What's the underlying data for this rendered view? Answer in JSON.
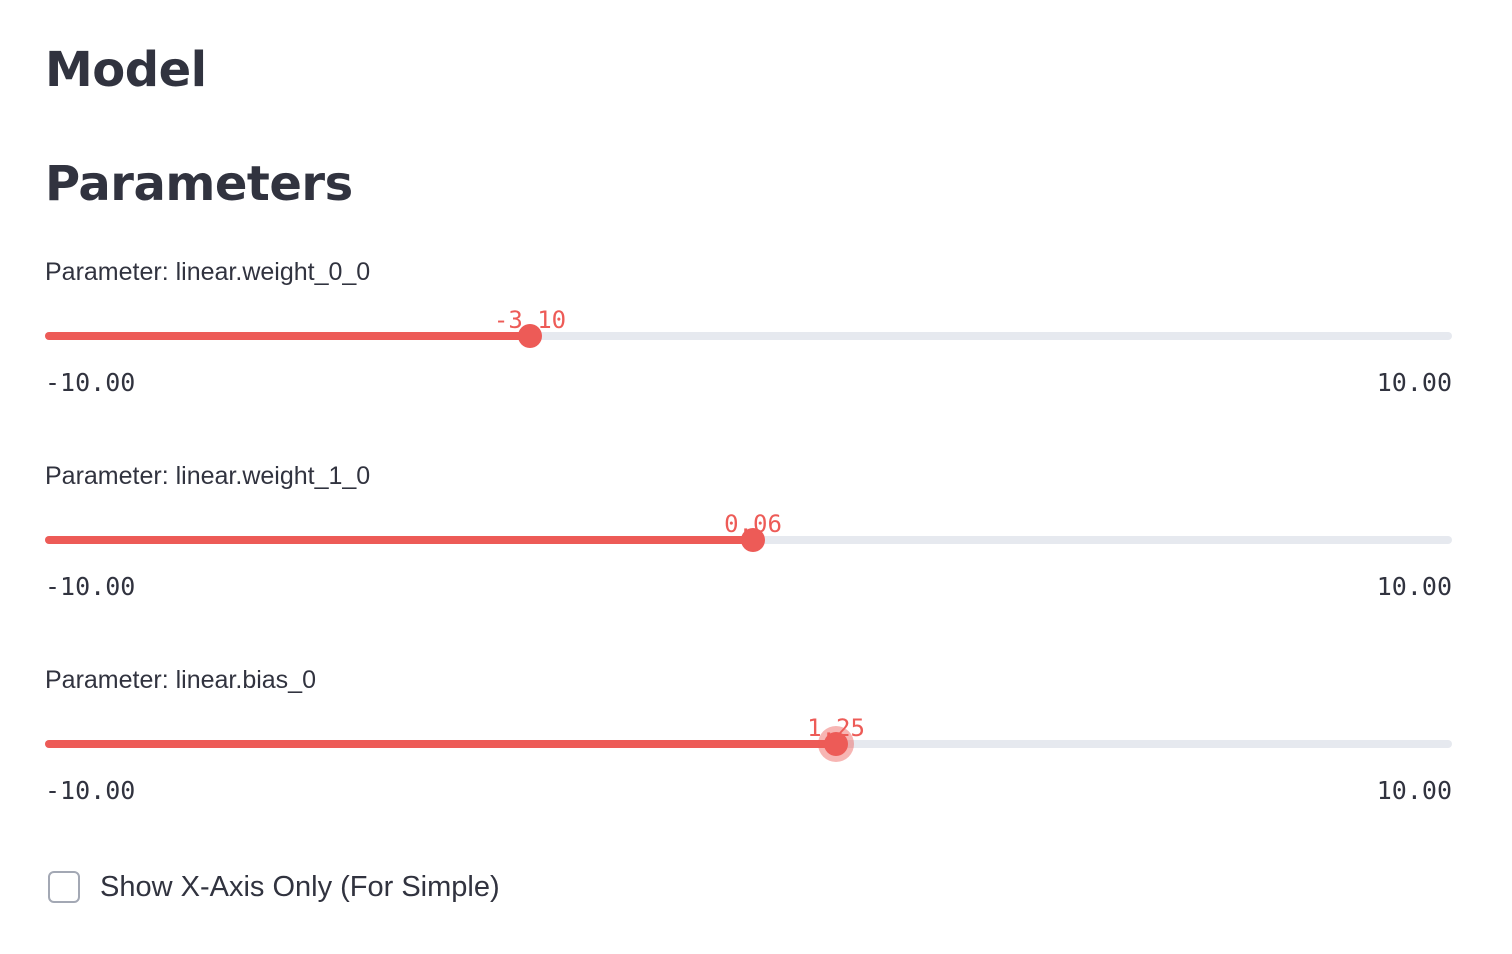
{
  "headings": {
    "model": "Model",
    "parameters": "Parameters"
  },
  "colors": {
    "accent": "#ed5b57",
    "track": "#e6e9ef",
    "text": "#31333f"
  },
  "sliders": [
    {
      "label": "Parameter: linear.weight_0_0",
      "value": -3.1,
      "value_text": "-3.10",
      "min": -10,
      "max": 10,
      "min_text": "-10.00",
      "max_text": "10.00",
      "focused": false
    },
    {
      "label": "Parameter: linear.weight_1_0",
      "value": 0.06,
      "value_text": "0.06",
      "min": -10,
      "max": 10,
      "min_text": "-10.00",
      "max_text": "10.00",
      "focused": false
    },
    {
      "label": "Parameter: linear.bias_0",
      "value": 1.25,
      "value_text": "1.25",
      "min": -10,
      "max": 10,
      "min_text": "-10.00",
      "max_text": "10.00",
      "focused": true
    }
  ],
  "checkbox": {
    "label": "Show X-Axis Only (For Simple)",
    "checked": false
  }
}
